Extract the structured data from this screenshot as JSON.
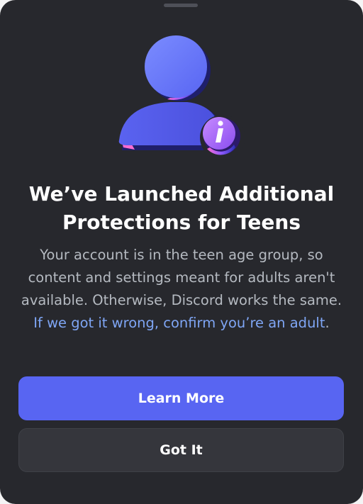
{
  "dialog": {
    "title_line1": "We’ve Launched Additional",
    "title_line2": "Protections for Teens",
    "body": "Your account is in the teen age group, so content and settings meant for adults aren't available. Otherwise, Discord works the same. ",
    "link": "If we got it wrong, confirm you’re an adult",
    "link_suffix": "."
  },
  "buttons": {
    "primary_label": "Learn More",
    "secondary_label": "Got It"
  },
  "icons": {
    "hero": "user-info-icon",
    "badge": "info-icon"
  },
  "colors": {
    "background": "#27282d",
    "primary": "#5865f2",
    "secondary": "#35363c",
    "link": "#7fa6f5"
  }
}
